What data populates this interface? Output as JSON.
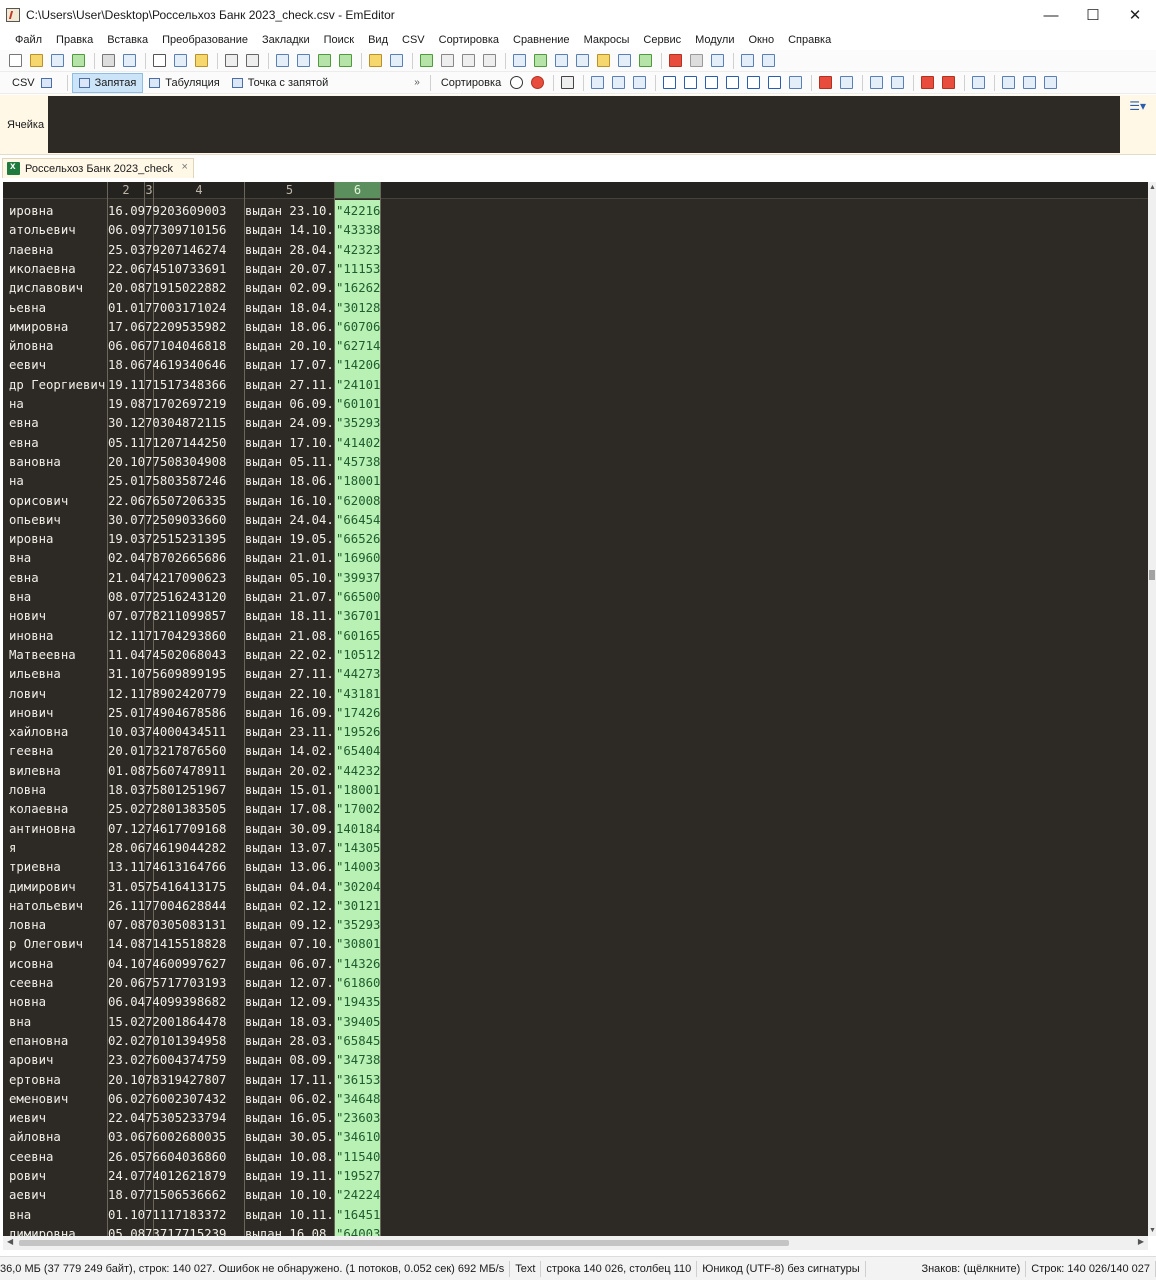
{
  "window": {
    "title": "C:\\Users\\User\\Desktop\\Россельхоз Банк 2023_check.csv - EmEditor",
    "minimize": "—",
    "maximize": "☐",
    "close": "✕"
  },
  "menu": [
    "Файл",
    "Правка",
    "Вставка",
    "Преобразование",
    "Закладки",
    "Поиск",
    "Вид",
    "CSV",
    "Сортировка",
    "Сравнение",
    "Макросы",
    "Сервис",
    "Модули",
    "Окно",
    "Справка"
  ],
  "toolbar2": {
    "csv": "CSV",
    "comma": "Запятая",
    "tab": "Табуляция",
    "semicolon": "Точка с запятой",
    "more": "»",
    "sort": "Сортировка"
  },
  "cellbar": {
    "label": "Ячейка"
  },
  "tab": {
    "name": "Россельхоз Банк 2023_check",
    "close": "×"
  },
  "columns": {
    "c2": "2",
    "c3": "3",
    "c4": "4",
    "c5": "5",
    "c6": "6"
  },
  "rows": [
    [
      "ировна",
      "16.0979203609003",
      "выдан 23.10.",
      "\"42216"
    ],
    [
      "атольевич",
      "06.0977309710156",
      "выдан 14.10.",
      "\"43338"
    ],
    [
      "лаевна",
      "25.0379207146274",
      "выдан 28.04.",
      "\"42323"
    ],
    [
      "иколаевна",
      "22.0674510733691",
      "выдан 20.07.",
      "\"11153"
    ],
    [
      "диславович",
      "20.0871915022882",
      "выдан 02.09.",
      "\"16262"
    ],
    [
      "ьевна",
      "01.0177003171024",
      "выдан 18.04.",
      "\"30128"
    ],
    [
      "имировна",
      "17.0672209535982",
      "выдан 18.06.",
      "\"60706"
    ],
    [
      "йловна",
      "06.0677104046818",
      "выдан 20.10.",
      "\"62714"
    ],
    [
      "еевич",
      "18.0674619340646",
      "выдан 17.07.",
      "\"14206"
    ],
    [
      "др Георгиевич",
      "19.1171517348366",
      "выдан 27.11.",
      "\"24101"
    ],
    [
      "на",
      "19.0871702697219",
      "выдан 06.09.",
      "\"60101"
    ],
    [
      "евна",
      "30.1270304872115",
      "выдан 24.09.",
      "\"35293"
    ],
    [
      "евна",
      "05.1171207144250",
      "выдан 17.10.",
      "\"41402"
    ],
    [
      "вановна",
      "20.1077508304908",
      "выдан 05.11.",
      "\"45738"
    ],
    [
      "на",
      "25.0175803587246",
      "выдан 18.06.",
      "\"18001"
    ],
    [
      "орисович",
      "22.0676507206335",
      "выдан 16.10.",
      "\"62008"
    ],
    [
      "опьевич",
      "30.0772509033660",
      "выдан 24.04.",
      "\"66454"
    ],
    [
      "ировна",
      "19.0372515231395",
      "выдан 19.05.",
      "\"66526"
    ],
    [
      "вна",
      "02.0478702665686",
      "выдан 21.01.",
      "\"16960"
    ],
    [
      "евна",
      "21.0474217090623",
      "выдан 05.10.",
      "\"39937"
    ],
    [
      "вна",
      "08.0772516243120",
      "выдан 21.07.",
      "\"66500"
    ],
    [
      "нович",
      "07.0778211099857",
      "выдан 18.11.",
      "\"36701"
    ],
    [
      "иновна",
      "12.1171704293860",
      "выдан 21.08.",
      "\"60165"
    ],
    [
      "Матвеевна",
      "11.0474502068043",
      "выдан 22.02.",
      "\"10512"
    ],
    [
      "ильевна",
      "31.1075609899195",
      "выдан 27.11.",
      "\"44273"
    ],
    [
      "лович",
      "12.1178902420779",
      "выдан 22.10.",
      "\"43181"
    ],
    [
      "инович",
      "25.0174904678586",
      "выдан 16.09.",
      "\"17426"
    ],
    [
      "хайловна",
      "10.0374000434511",
      "выдан 23.11.",
      "\"19526"
    ],
    [
      "геевна",
      "20.0173217876560",
      "выдан 14.02.",
      "\"65404"
    ],
    [
      "вилевна",
      "01.0875607478911",
      "выдан 20.02.",
      "\"44232"
    ],
    [
      "ловна",
      "18.0375801251967",
      "выдан 15.01.",
      "\"18001"
    ],
    [
      "колаевна",
      "25.0272801383505",
      "выдан 17.08.",
      "\"17002"
    ],
    [
      "антиновна",
      "07.1274617709168",
      "выдан 30.09.",
      "140184"
    ],
    [
      "я",
      "28.0674619044282",
      "выдан 13.07.",
      "\"14305"
    ],
    [
      "триевна",
      "13.1174613164766",
      "выдан 13.06.",
      "\"14003"
    ],
    [
      "димирович",
      "31.0575416413175",
      "выдан 04.04.",
      "\"30204"
    ],
    [
      "натольевич",
      "26.1177004628844",
      "выдан 02.12.",
      "\"30121"
    ],
    [
      "ловна",
      "07.0870305083131",
      "выдан 09.12.",
      "\"35293"
    ],
    [
      "р Олегович",
      "14.0871415518828",
      "выдан 07.10.",
      "\"30801"
    ],
    [
      "исовна",
      "04.1074600997627",
      "выдан 06.07.",
      "\"14326"
    ],
    [
      "сеевна",
      "20.0675717703193",
      "выдан 12.07.",
      "\"61860"
    ],
    [
      "новна",
      "06.0474099398682",
      "выдан 12.09.",
      "\"19435"
    ],
    [
      "вна",
      "15.0272001864478",
      "выдан 18.03.",
      "\"39405"
    ],
    [
      "епановна",
      "02.0270101394958",
      "выдан 28.03.",
      "\"65845"
    ],
    [
      "арович",
      "23.0276004374759",
      "выдан 08.09.",
      "\"34738"
    ],
    [
      "ертовна",
      "20.1078319427807",
      "выдан 17.11.",
      "\"36153"
    ],
    [
      "еменович",
      "06.0276002307432",
      "выдан 06.02.",
      "\"34648"
    ],
    [
      "иевич",
      "22.0475305233794",
      "выдан 16.05.",
      "\"23603"
    ],
    [
      "айловна",
      "03.0676002680035",
      "выдан 30.05.",
      "\"34610"
    ],
    [
      "сеевна",
      "26.0576604036860",
      "выдан 10.08.",
      "\"11540"
    ],
    [
      "рович",
      "24.0774012621879",
      "выдан 19.11.",
      "\"19527"
    ],
    [
      "аевич",
      "18.0771506536662",
      "выдан 10.10.",
      "\"24224"
    ],
    [
      "вна",
      "01.1071117183372",
      "выдан 10.11.",
      "\"16451"
    ],
    [
      "димировна",
      "05.0873717715239",
      "выдан 16.08.",
      "\"64003"
    ]
  ],
  "status": {
    "size": "36,0 МБ (37 779 249 байт), строк: 140 027. Ошибок не обнаружено. (1 потоков, 0.052 сек) 692 МБ/s",
    "mode": "Text",
    "position": "строка 140 026, столбец 110",
    "encoding": "Юникод (UTF-8) без сигнатуры",
    "chars": "Знаков: (щёлкните)",
    "lines": "Строк: 140 026/140 027"
  }
}
